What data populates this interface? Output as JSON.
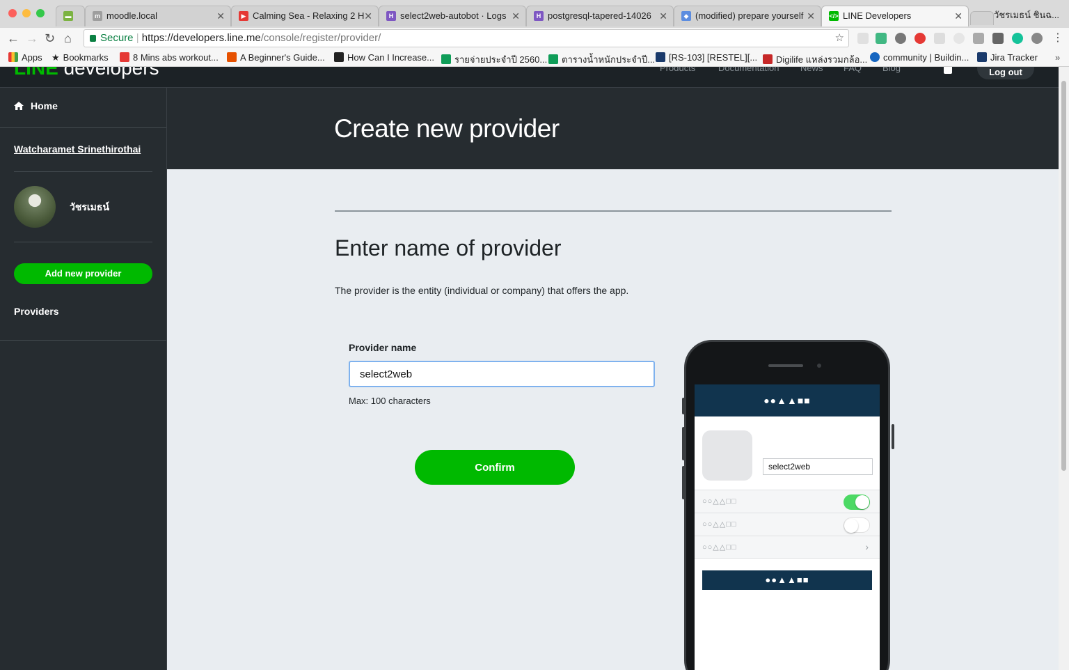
{
  "browser": {
    "tabs": [
      {
        "title": "",
        "favicon_color": "#7cb342",
        "favicon_icon": "app-icon"
      },
      {
        "title": "moodle.local",
        "favicon_color": "#9e9e9e",
        "favicon_icon": "moodle-icon"
      },
      {
        "title": "Calming Sea - Relaxing 2 H",
        "favicon_color": "#e53935",
        "favicon_icon": "youtube-icon"
      },
      {
        "title": "select2web-autobot · Logs",
        "favicon_color": "#7e57c2",
        "favicon_icon": "heroku-icon"
      },
      {
        "title": "postgresql-tapered-14026",
        "favicon_color": "#7e57c2",
        "favicon_icon": "heroku-icon"
      },
      {
        "title": "(modified) prepare yourself",
        "favicon_color": "#5c8de0",
        "favicon_icon": "stackedit-icon"
      },
      {
        "title": "LINE Developers",
        "favicon_color": "#00b900",
        "favicon_icon": "code-icon"
      }
    ],
    "profile_name": "วัชรเมธน์ ชินฉ...",
    "url_secure_label": "Secure",
    "url_host": "https://developers.line.me",
    "url_path": "/console/register/provider/",
    "bookmarks": [
      {
        "label": "Apps",
        "color": "#e53935"
      },
      {
        "label": "Bookmarks",
        "color": "#555555"
      },
      {
        "label": "8 Mins abs workout...",
        "color": "#e53935"
      },
      {
        "label": "A Beginner's Guide...",
        "color": "#e65100"
      },
      {
        "label": "How Can I Increase...",
        "color": "#222222"
      },
      {
        "label": "รายจ่ายประจำปี 2560...",
        "color": "#0f9d58"
      },
      {
        "label": "ตารางน้ำหนักประจำปี...",
        "color": "#0f9d58"
      },
      {
        "label": "[RS-103] [RESTEL][...",
        "color": "#1a3a6b"
      },
      {
        "label": "Digilife แหล่งรวมกล้อ...",
        "color": "#c62828"
      },
      {
        "label": "community | Buildin...",
        "color": "#1565c0"
      },
      {
        "label": "Jira Tracker",
        "color": "#1a3a6b"
      }
    ]
  },
  "topnav": {
    "logo_line": "LINE",
    "logo_rest": "developers",
    "links": [
      "Products",
      "Documentation",
      "News",
      "FAQ",
      "Blog"
    ],
    "logout_label": "Log out"
  },
  "sidebar": {
    "home_label": "Home",
    "user_link": "Watcharamet Srinethirothai",
    "display_name": "วัชรเมธน์",
    "add_provider_label": "Add new provider",
    "providers_label": "Providers"
  },
  "main": {
    "page_title": "Create new provider",
    "section_title": "Enter name of provider",
    "description": "The provider is the entity (individual or company) that offers the app.",
    "field_label": "Provider name",
    "field_value": "select2web",
    "field_hint": "Max: 100 characters",
    "confirm_label": "Confirm"
  },
  "phone_preview": {
    "header_text": "●●▲▲■■",
    "input_value": "select2web",
    "rows": [
      {
        "label": "○○△△□□",
        "toggle": "on"
      },
      {
        "label": "○○△△□□",
        "toggle": "off"
      },
      {
        "label": "○○△△□□",
        "toggle": "chevron"
      }
    ],
    "button_text": "●●▲▲■■"
  },
  "colors": {
    "line_green": "#00b900",
    "dark_bg": "#262c30",
    "navy": "#11344e",
    "toggle_on": "#4cd964"
  }
}
